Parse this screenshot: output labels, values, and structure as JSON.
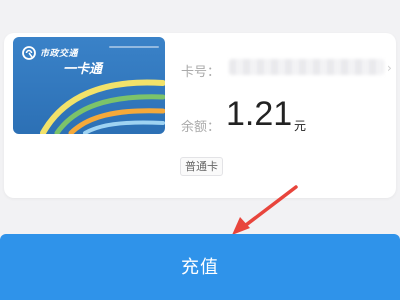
{
  "card": {
    "logo_text": "市政交通",
    "name_text": "一卡通"
  },
  "info": {
    "card_number_label": "卡号：",
    "card_number_value": "",
    "balance_label": "余额：",
    "balance_value": "1.21",
    "balance_unit": "元",
    "card_type": "普通卡"
  },
  "actions": {
    "recharge_label": "充值"
  },
  "colors": {
    "primary_button": "#2f93ea",
    "card_blue": "#2c70b5",
    "annotation_arrow": "#e8453c"
  },
  "icons": {
    "chevron": "chevron-right-icon",
    "logo": "transit-logo-icon"
  }
}
